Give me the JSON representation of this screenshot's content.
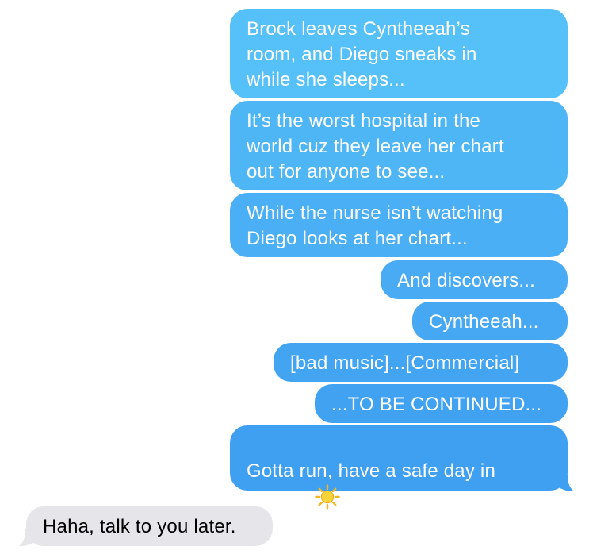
{
  "conversation": {
    "outgoing": [
      {
        "text": "Brock leaves Cyntheeah’s\nroom, and Diego sneaks in\nwhile she sleeps..."
      },
      {
        "text": "It’s the worst hospital in the\nworld cuz they leave her chart\nout for anyone to see..."
      },
      {
        "text": "While the nurse isn’t watching\nDiego looks at her chart..."
      },
      {
        "text": "And discovers..."
      },
      {
        "text": "Cyntheeah..."
      },
      {
        "text": "[bad music]...[Commercial]"
      },
      {
        "text": "...TO BE CONTINUED..."
      },
      {
        "text": "Gotta run, have a safe day in\nthe sun",
        "emoji": "sun-icon"
      }
    ],
    "incoming": [
      {
        "text": "Haha, talk to you later."
      }
    ]
  },
  "colors": {
    "outgoing_top": "#56c1f9",
    "outgoing_bottom": "#3aa2f1",
    "incoming": "#e5e5ea",
    "sun": "#f7c22b"
  }
}
